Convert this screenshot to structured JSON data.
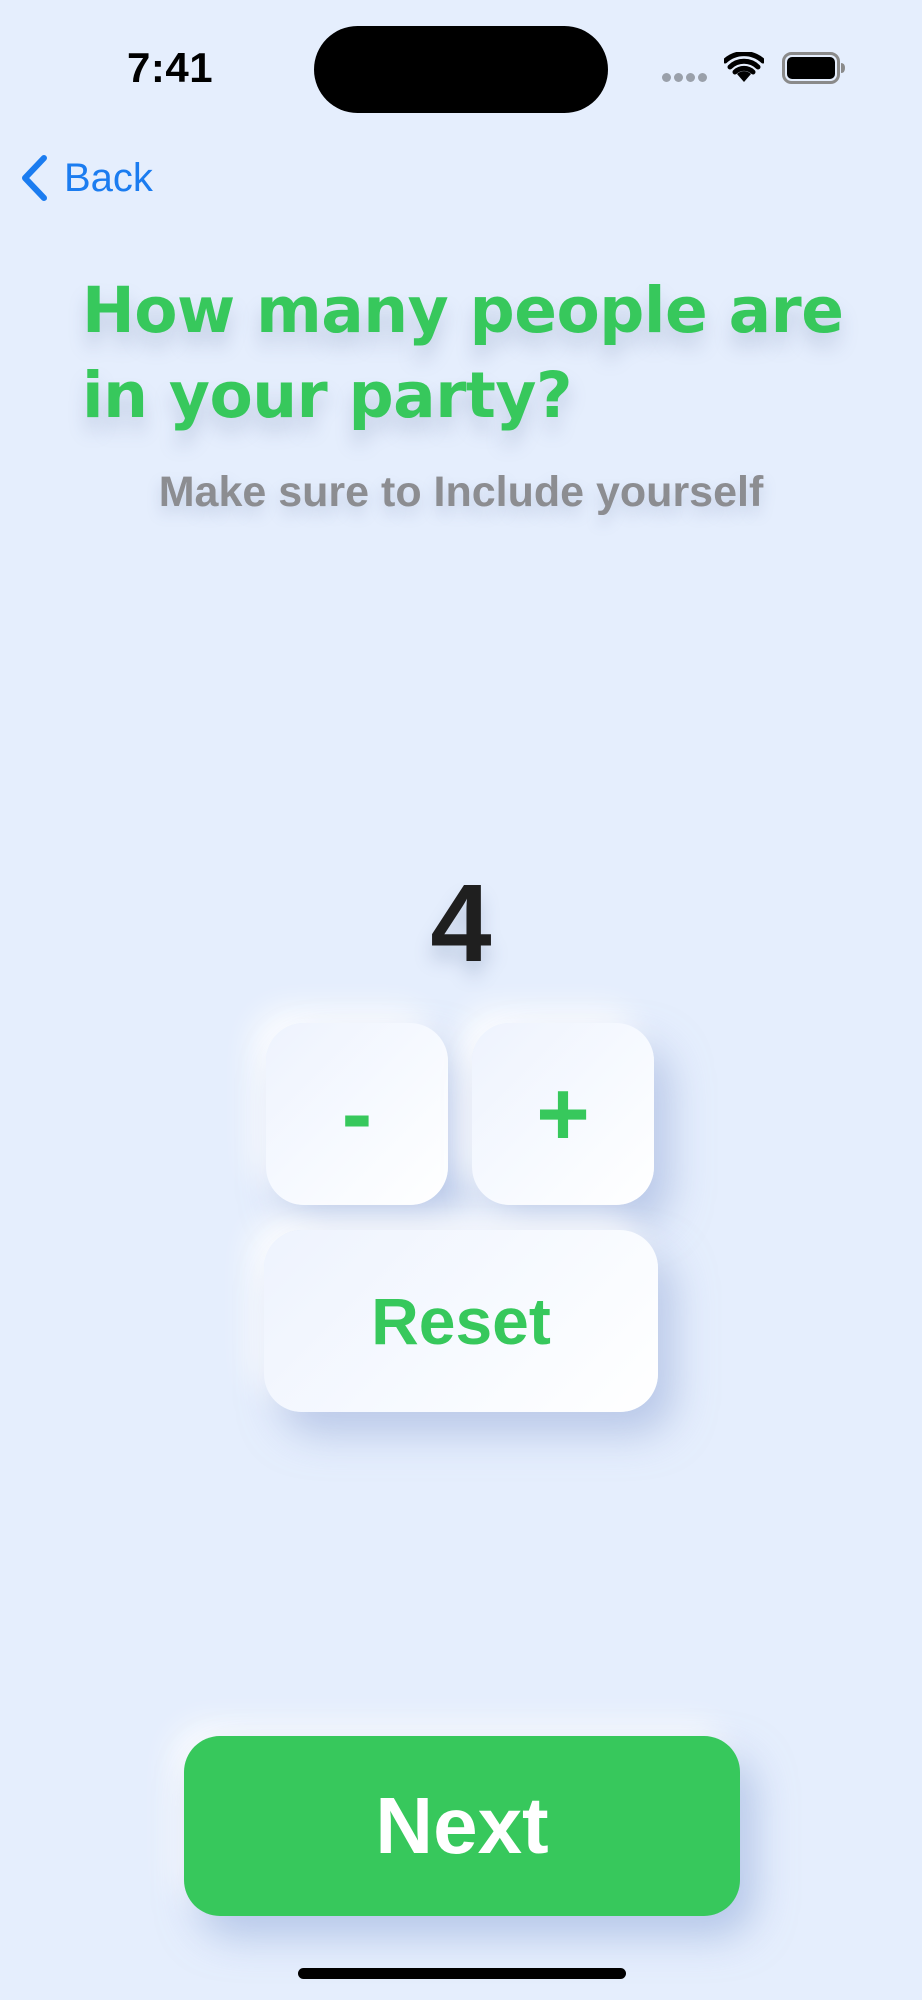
{
  "status_bar": {
    "time": "7:41",
    "icons": [
      "cellular-signal-icon",
      "wifi-icon",
      "battery-icon"
    ]
  },
  "nav": {
    "back_label": "Back"
  },
  "header": {
    "title": "How many people are in your party?",
    "subtitle": "Make sure to Include yourself"
  },
  "counter": {
    "value": "4",
    "minus_label": "-",
    "plus_label": "+",
    "reset_label": "Reset"
  },
  "footer": {
    "next_label": "Next"
  },
  "colors": {
    "accent": "#37c85c",
    "link": "#1b7cf0",
    "background": "#e5eefd",
    "subtitle": "#8c8d91"
  }
}
